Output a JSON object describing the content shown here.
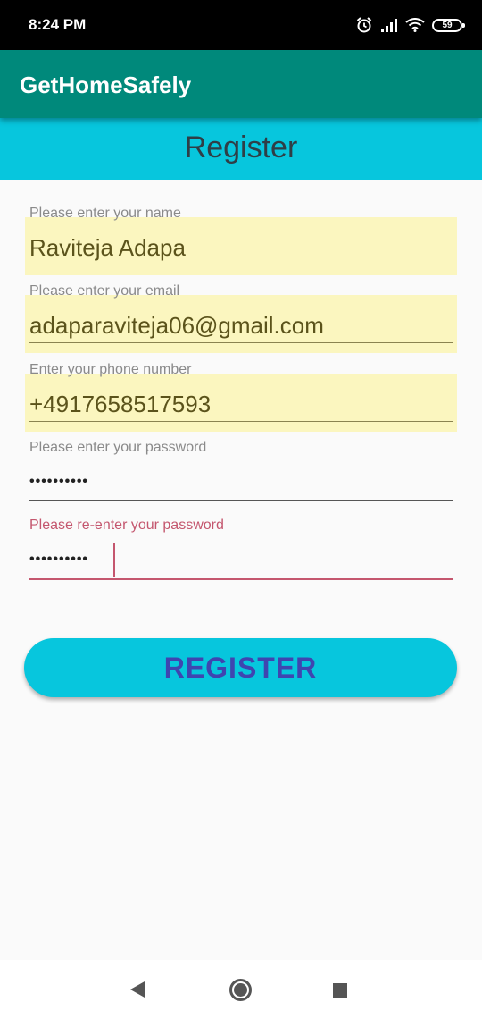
{
  "status_bar": {
    "time": "8:24 PM",
    "icons": [
      "alarm-icon",
      "signal-icon",
      "wifi-icon",
      "battery-icon"
    ],
    "battery_level": "59"
  },
  "app_bar": {
    "title": "GetHomeSafely",
    "color": "#00897b"
  },
  "header": {
    "title": "Register",
    "color": "#07c6dd"
  },
  "form": {
    "name": {
      "label": "Please enter your name",
      "value": "Raviteja Adapa"
    },
    "email": {
      "label": "Please enter your email",
      "value": "adaparaviteja06@gmail.com"
    },
    "phone": {
      "label": "Enter your phone number",
      "value": "+4917658517593"
    },
    "password": {
      "label": "Please enter your password",
      "value": "••••••••••"
    },
    "confirm_password": {
      "label": "Please re-enter your password",
      "value": "••••••••••"
    }
  },
  "register_button": {
    "label": "REGISTER"
  },
  "nav_bar": {
    "icons": [
      "back-icon",
      "home-icon",
      "recents-icon"
    ]
  },
  "colors": {
    "autofill": "#fbf6bf",
    "focus_accent": "#c4566e",
    "button_text": "#3f45b0"
  }
}
